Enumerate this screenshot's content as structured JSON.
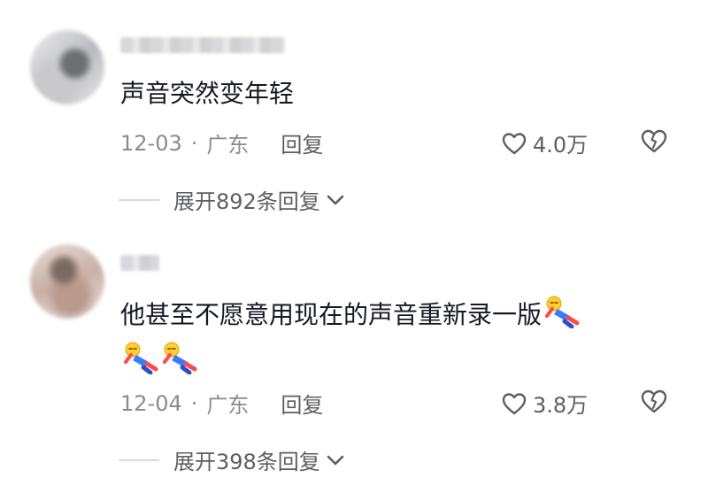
{
  "comments": [
    {
      "text": "声音突然变年轻",
      "date": "12-03",
      "separator": "·",
      "location": "广东",
      "reply_label": "回复",
      "like_count": "4.0万",
      "expand_label": "展开892条回复"
    },
    {
      "text": "他甚至不愿意用现在的声音重新录一版",
      "date": "12-04",
      "separator": "·",
      "location": "广东",
      "reply_label": "回复",
      "like_count": "3.8万",
      "expand_label": "展开398条回复"
    }
  ],
  "colors": {
    "text": "#161823",
    "meta": "#8a8b91",
    "secondary": "#5d5e64"
  },
  "icons": [
    "heart-outline-icon",
    "broken-heart-icon",
    "chevron-down-icon",
    "falling-person-emoji"
  ]
}
